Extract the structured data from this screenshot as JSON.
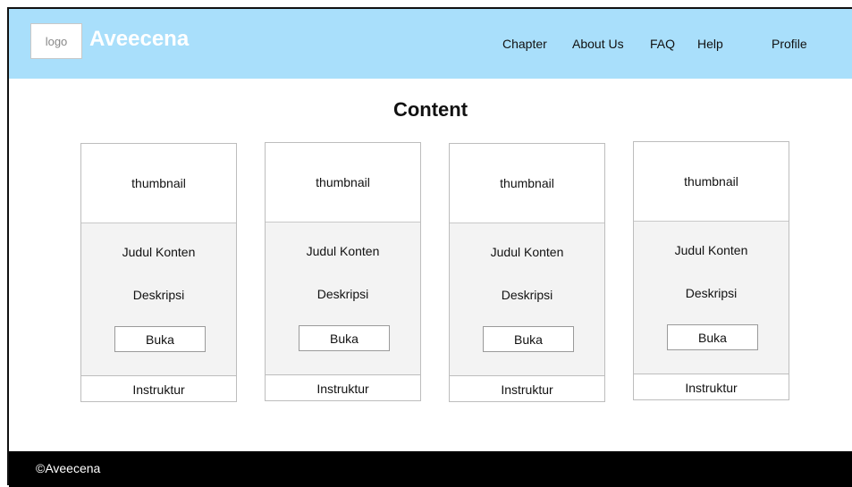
{
  "header": {
    "logo_label": "logo",
    "brand": "Aveecena",
    "nav": [
      "Chapter",
      "About Us",
      "FAQ",
      "Help",
      "Profile"
    ]
  },
  "main": {
    "title": "Content",
    "cards": [
      {
        "thumbnail": "thumbnail",
        "judul": "Judul Konten",
        "deskripsi": "Deskripsi",
        "button": "Buka",
        "instruktur": "Instruktur"
      },
      {
        "thumbnail": "thumbnail",
        "judul": "Judul Konten",
        "deskripsi": "Deskripsi",
        "button": "Buka",
        "instruktur": "Instruktur"
      },
      {
        "thumbnail": "thumbnail",
        "judul": "Judul Konten",
        "deskripsi": "Deskripsi",
        "button": "Buka",
        "instruktur": "Instruktur"
      },
      {
        "thumbnail": "thumbnail",
        "judul": "Judul Konten",
        "deskripsi": "Deskripsi",
        "button": "Buka",
        "instruktur": "Instruktur"
      }
    ]
  },
  "footer": {
    "copyright": "©Aveecena"
  },
  "colors": {
    "header_bg": "#a9dffb",
    "footer_bg": "#000000",
    "card_body_bg": "#f3f3f3"
  }
}
